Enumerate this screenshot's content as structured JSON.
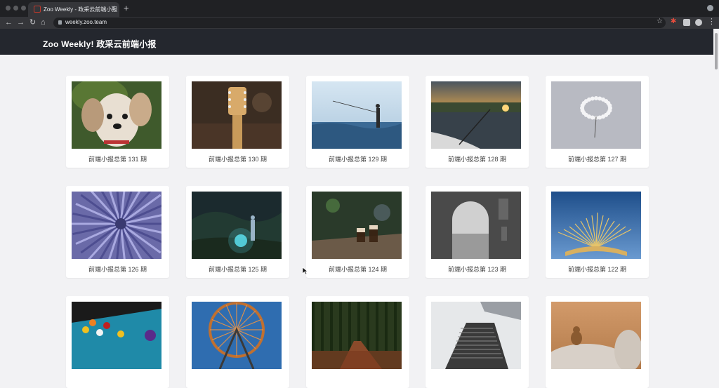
{
  "browser": {
    "tab_title": "Zoo Weekly - 政采云前端小报",
    "tab_close": "×",
    "new_tab": "+",
    "url": "weekly.zoo.team",
    "icons": [
      "back-icon",
      "forward-icon",
      "reload-icon",
      "home-icon",
      "lock-icon",
      "star-icon",
      "extension-icon",
      "profile-icon",
      "menu-icon"
    ]
  },
  "site": {
    "title": "Zoo Weekly! 政采云前端小报"
  },
  "issues": [
    {
      "label": "前端小报总第 131 期",
      "image": "dog"
    },
    {
      "label": "前端小报总第 130 期",
      "image": "guitar"
    },
    {
      "label": "前端小报总第 129 期",
      "image": "fisherman"
    },
    {
      "label": "前端小报总第 128 期",
      "image": "boat-sunset"
    },
    {
      "label": "前端小报总第 127 期",
      "image": "dandelion"
    },
    {
      "label": "前端小报总第 126 期",
      "image": "blue-flower"
    },
    {
      "label": "前端小报总第 125 期",
      "image": "forest-light"
    },
    {
      "label": "前端小报总第 124 期",
      "image": "coffee-glasses"
    },
    {
      "label": "前端小报总第 123 期",
      "image": "arch-bw"
    },
    {
      "label": "前端小报总第 122 期",
      "image": "book-sky"
    },
    {
      "label": "",
      "image": "pool-table"
    },
    {
      "label": "",
      "image": "ferris-wheel"
    },
    {
      "label": "",
      "image": "autumn-path"
    },
    {
      "label": "",
      "image": "skyscraper"
    },
    {
      "label": "",
      "image": "squirrel"
    }
  ]
}
